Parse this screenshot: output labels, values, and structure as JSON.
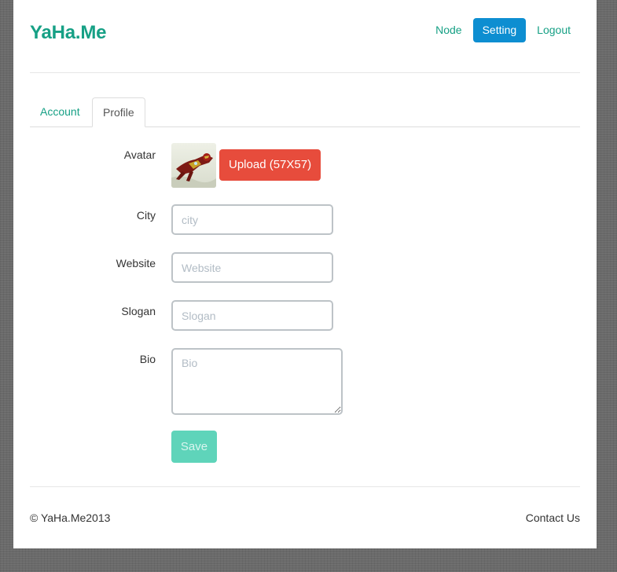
{
  "header": {
    "brand": "YaHa.Me",
    "nav": [
      {
        "label": "Node",
        "active": false
      },
      {
        "label": "Setting",
        "active": true
      },
      {
        "label": "Logout",
        "active": false
      }
    ]
  },
  "tabs": [
    {
      "label": "Account",
      "active": false
    },
    {
      "label": "Profile",
      "active": true
    }
  ],
  "form": {
    "avatar_label": "Avatar",
    "upload_label": "Upload (57X57)",
    "city": {
      "label": "City",
      "placeholder": "city",
      "value": ""
    },
    "website": {
      "label": "Website",
      "placeholder": "Website",
      "value": ""
    },
    "slogan": {
      "label": "Slogan",
      "placeholder": "Slogan",
      "value": ""
    },
    "bio": {
      "label": "Bio",
      "placeholder": "Bio",
      "value": ""
    },
    "save_label": "Save"
  },
  "footer": {
    "copyright": "© YaHa.Me2013",
    "contact": "Contact Us"
  },
  "colors": {
    "brand": "#16a085",
    "active_nav": "#0d8ed1",
    "upload_button": "#e74c3c",
    "save_button": "#5fd4ba"
  }
}
